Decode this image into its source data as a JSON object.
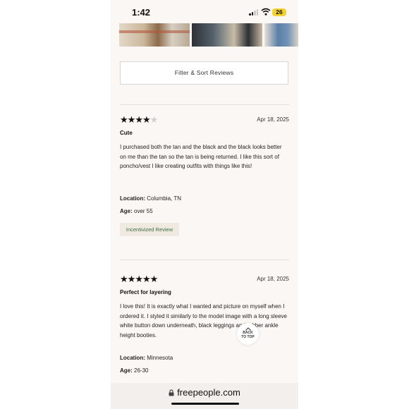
{
  "status": {
    "time": "1:42",
    "battery": "26"
  },
  "filter_label": "Filter & Sort Reviews",
  "reviews": [
    {
      "rating": 4,
      "max_rating": 5,
      "date": "Apr 18, 2025",
      "title": "Cute",
      "body": "I purchased both the tan and the black and the black looks better on me than the tan so the tan is being returned. I like this sort of poncho/vest I like creating outfits with things like this!",
      "location_label": "Location:",
      "location": "Columbia, TN",
      "age_label": "Age:",
      "age": "over 55",
      "badge": "Incentivized Review"
    },
    {
      "rating": 5,
      "max_rating": 5,
      "date": "Apr 18, 2025",
      "title": "Perfect for layering",
      "body": "I love this! It is exactly what I wanted and picture on myself when I ordered it. I styled it similarly to the model image with a long sleeve white button down underneath, black leggings and rubber ankle height booties.",
      "location_label": "Location:",
      "location": "Minnesota",
      "age_label": "Age:",
      "age": "26-30"
    }
  ],
  "back_to_top": {
    "line1": "BACK",
    "line2": "TO TOP"
  },
  "url": "freepeople.com",
  "icons": [
    "signal-icon",
    "wifi-icon",
    "battery-icon",
    "star-icon",
    "lock-icon",
    "caret-up-icon"
  ]
}
